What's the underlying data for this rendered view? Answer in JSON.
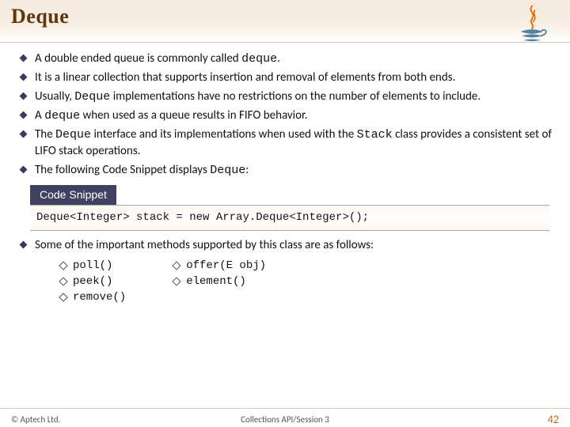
{
  "title": "Deque",
  "bullets": [
    {
      "pre": "A double ended queue is commonly called ",
      "mono": "deque",
      "post": "."
    },
    {
      "pre": "It is a linear collection that supports insertion and removal of elements from both ends.",
      "mono": "",
      "post": ""
    },
    {
      "pre": "Usually, ",
      "mono": "Deque",
      "post": " implementations have no restrictions on the number of elements to include."
    },
    {
      "pre": "A ",
      "mono": "deque",
      "post": " when used as a queue results in FIFO behavior."
    },
    {
      "pre": "The ",
      "mono": "Deque",
      "post": " interface and its implementations when used with the ",
      "mono2": "Stack",
      "post2": " class provides a consistent set of LIFO stack operations."
    },
    {
      "pre": "The following Code Snippet displays ",
      "mono": "Deque",
      "post": ":"
    }
  ],
  "snippet": {
    "tab": "Code Snippet",
    "code": "Deque<Integer> stack = new Array.Deque<Integer>();"
  },
  "methods_intro": "Some of the important methods supported by this class are as follows:",
  "methods_col1": [
    "poll()",
    "peek()",
    "remove()"
  ],
  "methods_col2": [
    "offer(E obj)",
    "element()"
  ],
  "footer": {
    "copyright": "© Aptech Ltd.",
    "session": "Collections API/Session 3",
    "page": "42"
  }
}
